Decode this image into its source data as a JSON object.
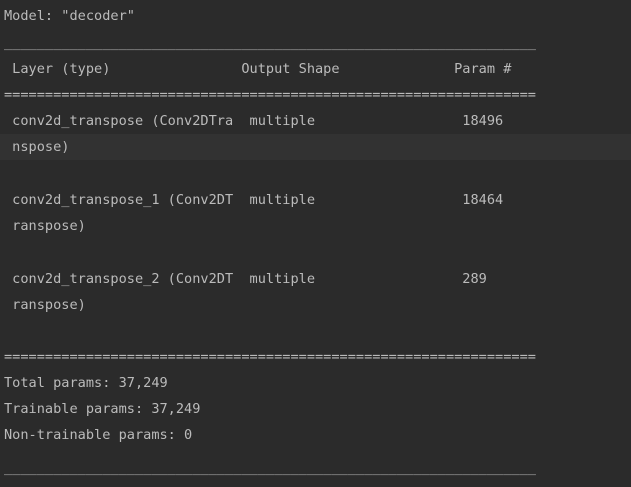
{
  "console": {
    "model_line": "Model: \"decoder\"",
    "rule_dash": "_________________________________________________________________",
    "header_line": " Layer (type)                Output Shape              Param #   ",
    "rule_eq": "=================================================================",
    "layers": [
      {
        "line1": " conv2d_transpose (Conv2DTra  multiple                  18496     ",
        "line2": " nspose)                                                         "
      },
      {
        "line1": " conv2d_transpose_1 (Conv2DT  multiple                  18464     ",
        "line2": " ranspose)                                                       "
      },
      {
        "line1": " conv2d_transpose_2 (Conv2DT  multiple                  289       ",
        "line2": " ranspose)                                                       "
      }
    ],
    "rule_eq_end": "=================================================================",
    "total_params": "Total params: 37,249",
    "trainable_params": "Trainable params: 37,249",
    "non_trainable_params": "Non-trainable params: 0",
    "rule_dash_end": "_________________________________________________________________"
  }
}
